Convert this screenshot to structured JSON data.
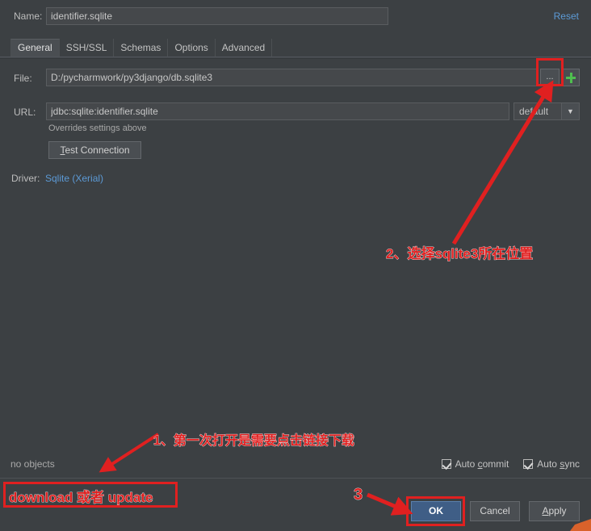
{
  "dialog": {
    "name_label": "Name:",
    "name_value": "identifier.sqlite",
    "reset_label": "Reset",
    "tabs": [
      {
        "label": "General",
        "active": true
      },
      {
        "label": "SSH/SSL",
        "active": false
      },
      {
        "label": "Schemas",
        "active": false
      },
      {
        "label": "Options",
        "active": false
      },
      {
        "label": "Advanced",
        "active": false
      }
    ],
    "file_label": "File:",
    "file_value": "D:/pycharmwork/py3django/db.sqlite3",
    "browse_button_label": "...",
    "add_button_label": "+",
    "url_label": "URL:",
    "url_value": "jdbc:sqlite:identifier.sqlite",
    "url_mode": "default",
    "url_dropdown_icon": "chevron-down-icon",
    "overrides_note": "Overrides settings above",
    "test_connection_label": "Test Connection",
    "test_connection_mnemonic": "T",
    "driver_label": "Driver:",
    "driver_value": "Sqlite (Xerial)"
  },
  "status": {
    "objects_text": "no objects"
  },
  "options": {
    "auto_commit_label": "Auto commit",
    "auto_commit_mnemonic": "c",
    "auto_commit_checked": true,
    "auto_sync_label": "Auto sync",
    "auto_sync_mnemonic": "s",
    "auto_sync_checked": true
  },
  "buttons": {
    "ok": "OK",
    "cancel": "Cancel",
    "apply": "Apply",
    "apply_mnemonic": "A"
  },
  "annotations": {
    "step1": "1、第一次打开是需要点击链接下载",
    "step2": "2、选择sqlite3所在位置",
    "step3": "3",
    "download_note": "download 或者 update",
    "color": "#e02020"
  }
}
